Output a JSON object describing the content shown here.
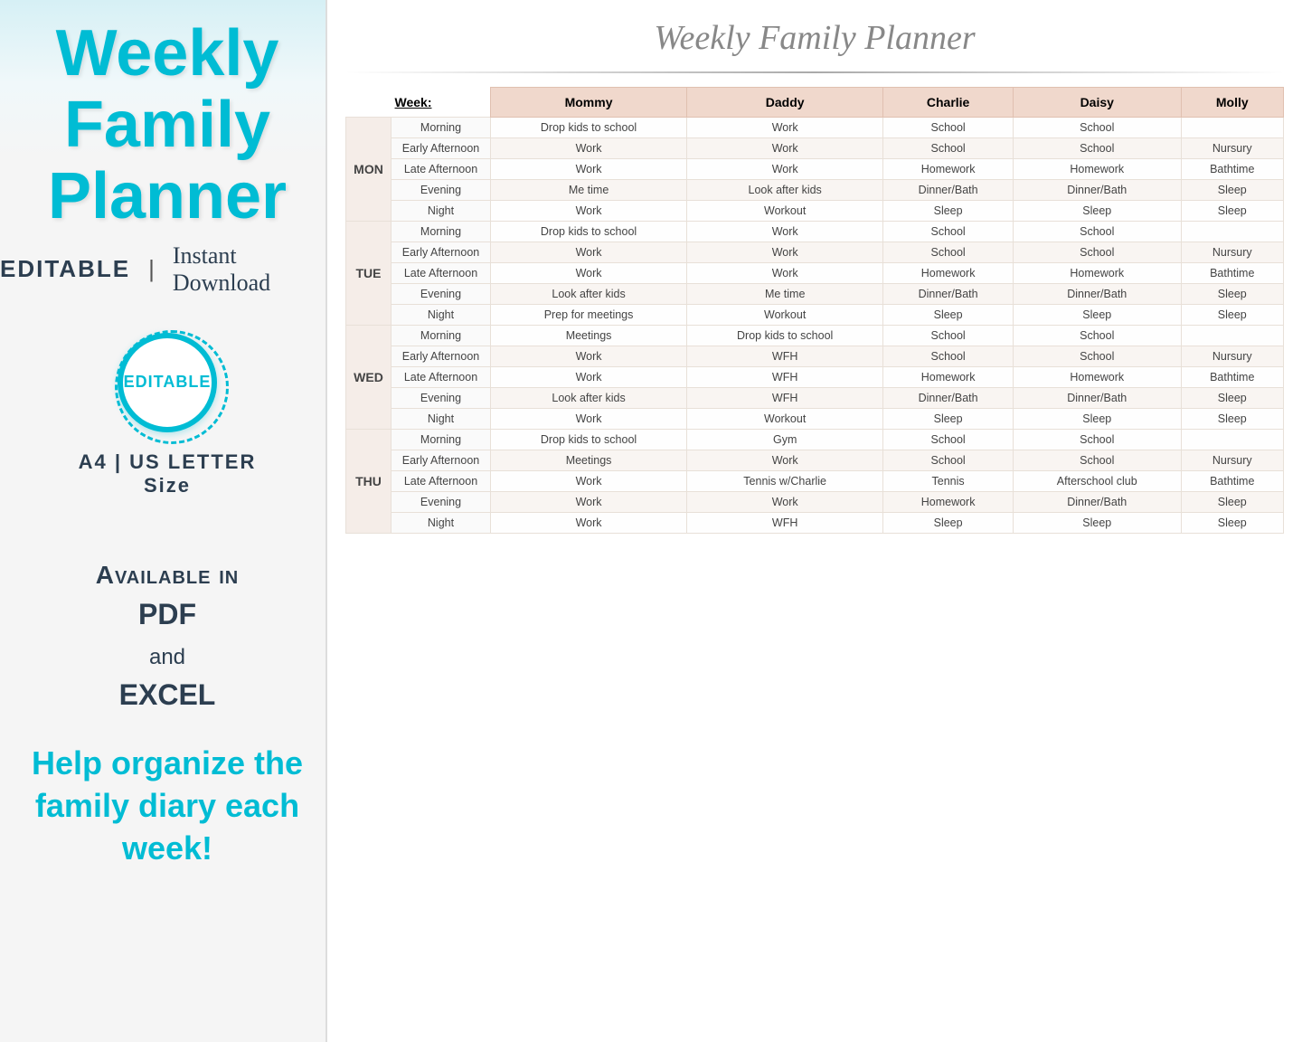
{
  "header": {
    "main_title": "Weekly Family Planner",
    "subtitle_editable": "EDITABLE",
    "subtitle_separator": "|",
    "subtitle_download": "Instant Download",
    "badge_text": "EDITABLE",
    "size_text": "A4 | US LETTER\nSize",
    "available_text": "Available in",
    "format_pdf": "PDF",
    "format_and": "and",
    "format_excel": "EXCEL",
    "help_text": "Help organize the family diary each week!",
    "planner_subtitle": "Weekly Family Planner"
  },
  "table": {
    "week_label": "Week:",
    "columns": [
      "Mommy",
      "Daddy",
      "Charlie",
      "Daisy",
      "Molly"
    ],
    "days": [
      {
        "day": "MON",
        "rows": [
          {
            "time": "Morning",
            "mommy": "Drop kids to school",
            "daddy": "Work",
            "charlie": "School",
            "daisy": "School",
            "molly": ""
          },
          {
            "time": "Early Afternoon",
            "mommy": "Work",
            "daddy": "Work",
            "charlie": "School",
            "daisy": "School",
            "molly": "Nursury"
          },
          {
            "time": "Late Afternoon",
            "mommy": "Work",
            "daddy": "Work",
            "charlie": "Homework",
            "daisy": "Homework",
            "molly": "Bathtime"
          },
          {
            "time": "Evening",
            "mommy": "Me time",
            "daddy": "Look after kids",
            "charlie": "Dinner/Bath",
            "daisy": "Dinner/Bath",
            "molly": "Sleep"
          },
          {
            "time": "Night",
            "mommy": "Work",
            "daddy": "Workout",
            "charlie": "Sleep",
            "daisy": "Sleep",
            "molly": "Sleep"
          }
        ]
      },
      {
        "day": "TUE",
        "rows": [
          {
            "time": "Morning",
            "mommy": "Drop kids to school",
            "daddy": "Work",
            "charlie": "School",
            "daisy": "School",
            "molly": ""
          },
          {
            "time": "Early Afternoon",
            "mommy": "Work",
            "daddy": "Work",
            "charlie": "School",
            "daisy": "School",
            "molly": "Nursury"
          },
          {
            "time": "Late Afternoon",
            "mommy": "Work",
            "daddy": "Work",
            "charlie": "Homework",
            "daisy": "Homework",
            "molly": "Bathtime"
          },
          {
            "time": "Evening",
            "mommy": "Look after kids",
            "daddy": "Me time",
            "charlie": "Dinner/Bath",
            "daisy": "Dinner/Bath",
            "molly": "Sleep"
          },
          {
            "time": "Night",
            "mommy": "Prep for meetings",
            "daddy": "Workout",
            "charlie": "Sleep",
            "daisy": "Sleep",
            "molly": "Sleep"
          }
        ]
      },
      {
        "day": "WED",
        "rows": [
          {
            "time": "Morning",
            "mommy": "Meetings",
            "daddy": "Drop kids to school",
            "charlie": "School",
            "daisy": "School",
            "molly": ""
          },
          {
            "time": "Early Afternoon",
            "mommy": "Work",
            "daddy": "WFH",
            "charlie": "School",
            "daisy": "School",
            "molly": "Nursury"
          },
          {
            "time": "Late Afternoon",
            "mommy": "Work",
            "daddy": "WFH",
            "charlie": "Homework",
            "daisy": "Homework",
            "molly": "Bathtime"
          },
          {
            "time": "Evening",
            "mommy": "Look after kids",
            "daddy": "WFH",
            "charlie": "Dinner/Bath",
            "daisy": "Dinner/Bath",
            "molly": "Sleep"
          },
          {
            "time": "Night",
            "mommy": "Work",
            "daddy": "Workout",
            "charlie": "Sleep",
            "daisy": "Sleep",
            "molly": "Sleep"
          }
        ]
      },
      {
        "day": "THU",
        "rows": [
          {
            "time": "Morning",
            "mommy": "Drop kids to school",
            "daddy": "Gym",
            "charlie": "School",
            "daisy": "School",
            "molly": ""
          },
          {
            "time": "Early Afternoon",
            "mommy": "Meetings",
            "daddy": "Work",
            "charlie": "School",
            "daisy": "School",
            "molly": "Nursury"
          },
          {
            "time": "Late Afternoon",
            "mommy": "Work",
            "daddy": "Tennis w/Charlie",
            "charlie": "Tennis",
            "daisy": "Afterschool club",
            "molly": "Bathtime"
          },
          {
            "time": "Evening",
            "mommy": "Work",
            "daddy": "Work",
            "charlie": "Homework",
            "daisy": "Dinner/Bath",
            "molly": "Sleep"
          },
          {
            "time": "Night",
            "mommy": "Work",
            "daddy": "WFH",
            "charlie": "Sleep",
            "daisy": "Sleep",
            "molly": "Sleep"
          }
        ]
      }
    ]
  },
  "colors": {
    "teal": "#00bcd4",
    "dark": "#2c3e50",
    "header_bg": "#f0d8cc",
    "marble_bg": "#f0f4f4"
  }
}
